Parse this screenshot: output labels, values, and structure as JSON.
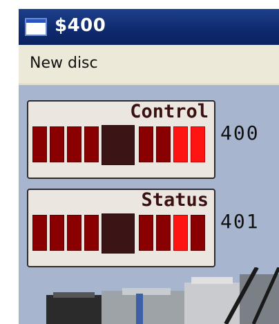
{
  "window": {
    "title": "$400",
    "menu": [
      "New disc"
    ]
  },
  "controls": [
    {
      "label": "Control",
      "value": "400",
      "leds": [
        "off",
        "off",
        "off",
        "off",
        "knob",
        "off",
        "off",
        "on",
        "on"
      ]
    },
    {
      "label": "Status",
      "value": "401",
      "leds": [
        "off",
        "off",
        "off",
        "off",
        "knob",
        "off",
        "off",
        "on",
        "off"
      ]
    }
  ],
  "colors": {
    "titlebar": "#0e2a6e",
    "led_off": "#8a0000",
    "led_on": "#ff1414",
    "knob": "#3b1515",
    "client_bg": "#a8b5cf"
  },
  "icons": {
    "window_icon": "app-window-icon"
  }
}
